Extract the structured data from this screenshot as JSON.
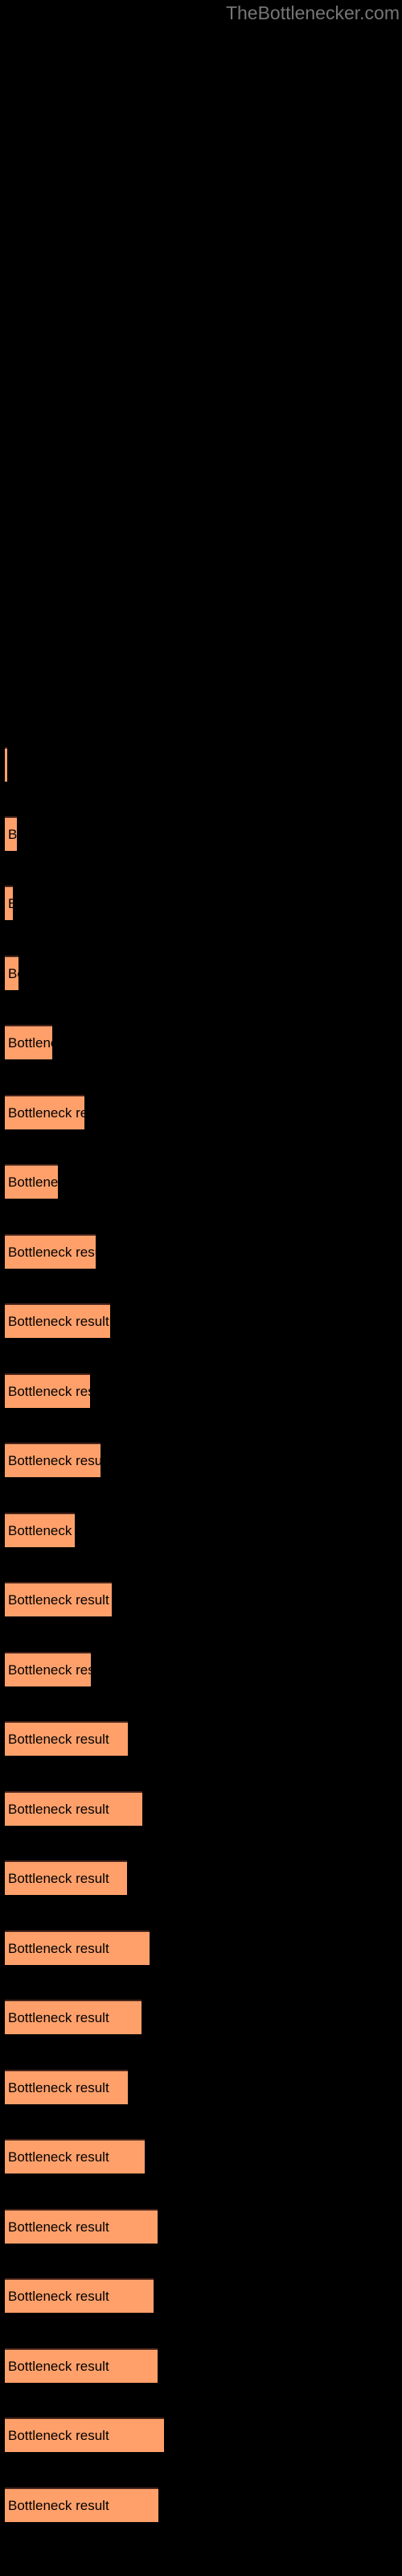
{
  "header": {
    "site_title": "TheBottlenecker.com"
  },
  "colors": {
    "background": "#000000",
    "bar_fill": "#FFA06A",
    "bar_border_top": "#45231A",
    "label_text": "#000000",
    "title_text": "#767676"
  },
  "chart_data": {
    "type": "bar",
    "orientation": "horizontal",
    "title": "",
    "subtitle": "",
    "xlabel": "",
    "ylabel": "",
    "grid": false,
    "legend": null,
    "bar_label_text": "Bottleneck result",
    "xlim": [
      0,
      500
    ],
    "categories": [
      "Bottleneck result",
      "Bottleneck result",
      "Bottleneck result",
      "Bottleneck result",
      "Bottleneck result",
      "Bottleneck result",
      "Bottleneck result",
      "Bottleneck result",
      "Bottleneck result",
      "Bottleneck result",
      "Bottleneck result",
      "Bottleneck result",
      "Bottleneck result",
      "Bottleneck result",
      "Bottleneck result",
      "Bottleneck result",
      "Bottleneck result",
      "Bottleneck result",
      "Bottleneck result",
      "Bottleneck result",
      "Bottleneck result",
      "Bottleneck result",
      "Bottleneck result",
      "Bottleneck result"
    ],
    "values": [
      3,
      15,
      10,
      17,
      59,
      99,
      66,
      113,
      131,
      106,
      119,
      87,
      133,
      107,
      153,
      171,
      152,
      163,
      181,
      170,
      185,
      180,
      190,
      191
    ],
    "bars": [
      {
        "index": 1,
        "top": 928,
        "width": 3,
        "label": "Bottleneck result"
      },
      {
        "index": 2,
        "top": 1014,
        "width": 15,
        "label": "Bottleneck result"
      },
      {
        "index": 3,
        "top": 1100,
        "width": 10,
        "label": "Bottleneck result"
      },
      {
        "index": 4,
        "top": 1187,
        "width": 17,
        "label": "Bottleneck result"
      },
      {
        "index": 5,
        "top": 1273,
        "width": 59,
        "label": "Bottleneck result"
      },
      {
        "index": 6,
        "top": 1360,
        "width": 99,
        "label": "Bottleneck result"
      },
      {
        "index": 7,
        "top": 1446,
        "width": 66,
        "label": "Bottleneck result"
      },
      {
        "index": 8,
        "top": 1533,
        "width": 113,
        "label": "Bottleneck result"
      },
      {
        "index": 9,
        "top": 1619,
        "width": 131,
        "label": "Bottleneck result"
      },
      {
        "index": 10,
        "top": 1706,
        "width": 106,
        "label": "Bottleneck result"
      },
      {
        "index": 11,
        "top": 1792,
        "width": 119,
        "label": "Bottleneck result"
      },
      {
        "index": 12,
        "top": 1879,
        "width": 87,
        "label": "Bottleneck result"
      },
      {
        "index": 13,
        "top": 1965,
        "width": 133,
        "label": "Bottleneck result"
      },
      {
        "index": 14,
        "top": 2052,
        "width": 107,
        "label": "Bottleneck result"
      },
      {
        "index": 15,
        "top": 2138,
        "width": 153,
        "label": "Bottleneck result"
      },
      {
        "index": 16,
        "top": 2225,
        "width": 171,
        "label": "Bottleneck result"
      },
      {
        "index": 17,
        "top": 2311,
        "width": 152,
        "label": "Bottleneck result"
      },
      {
        "index": 18,
        "top": 2398,
        "width": 180,
        "label": "Bottleneck result"
      },
      {
        "index": 19,
        "top": 2484,
        "width": 170,
        "label": "Bottleneck result"
      },
      {
        "index": 20,
        "top": 2571,
        "width": 153,
        "label": "Bottleneck result"
      },
      {
        "index": 21,
        "top": 2657,
        "width": 174,
        "label": "Bottleneck result"
      },
      {
        "index": 22,
        "top": 2744,
        "width": 190,
        "label": "Bottleneck result"
      },
      {
        "index": 23,
        "top": 2830,
        "width": 185,
        "label": "Bottleneck result"
      },
      {
        "index": 24,
        "top": 2917,
        "width": 190,
        "label": "Bottleneck result"
      },
      {
        "index": 25,
        "top": 3003,
        "width": 198,
        "label": "Bottleneck result"
      },
      {
        "index": 26,
        "top": 3090,
        "width": 191,
        "label": "Bottleneck result"
      }
    ]
  }
}
